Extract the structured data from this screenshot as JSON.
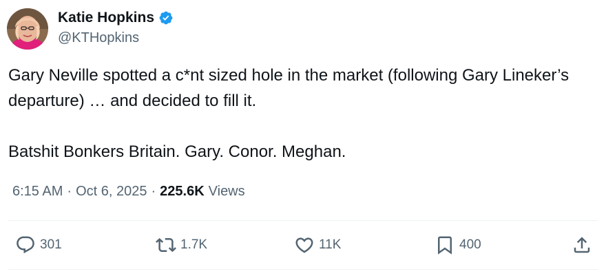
{
  "author": {
    "display_name": "Katie Hopkins",
    "handle": "@KTHopkins",
    "verified": true
  },
  "tweet": {
    "paragraphs": [
      "Gary Neville spotted a c*nt sized hole in the market (following Gary Lineker’s departure) … and decided to fill it.",
      "Batshit Bonkers Britain. Gary. Conor. Meghan."
    ],
    "time": "6:15 AM",
    "date": "Oct 6, 2025",
    "separator": "·",
    "views_count": "225.6K",
    "views_label": "Views"
  },
  "actions": {
    "replies": "301",
    "reposts": "1.7K",
    "likes": "11K",
    "bookmarks": "400"
  },
  "icons": {
    "reply": "reply-icon",
    "repost": "repost-icon",
    "like": "heart-icon",
    "bookmark": "bookmark-icon",
    "share": "share-icon",
    "verified": "verified-badge-icon"
  },
  "colors": {
    "text": "#0f1419",
    "secondary": "#536471",
    "verified": "#1d9bf0",
    "divider": "#eff3f4"
  }
}
